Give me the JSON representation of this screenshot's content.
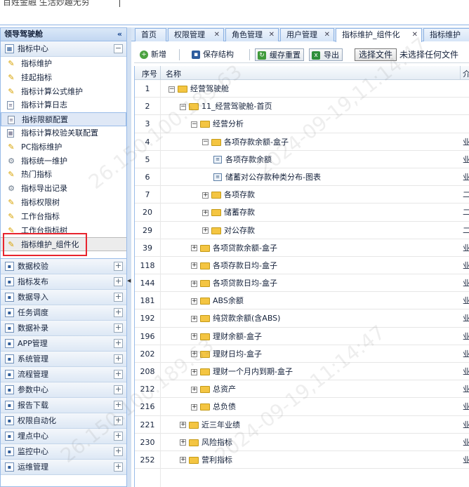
{
  "header": {
    "brand": "百姓金融 生活妙趣无穷"
  },
  "sidebar": {
    "title": "领导驾驶舱",
    "collapse_glyph": "«",
    "open_group": "指标中心",
    "items": [
      {
        "label": "指标维护",
        "icon": "pencil-icon"
      },
      {
        "label": "挂起指标",
        "icon": "pencil-icon"
      },
      {
        "label": "指标计算公式维护",
        "icon": "pencil-icon"
      },
      {
        "label": "指标计算日志",
        "icon": "document-icon"
      },
      {
        "label": "指标限额配置",
        "icon": "document-icon"
      },
      {
        "label": "指标计算校验关联配置",
        "icon": "table-icon"
      },
      {
        "label": "PC指标维护",
        "icon": "pencil-icon"
      },
      {
        "label": "指标统一维护",
        "icon": "gear-icon"
      },
      {
        "label": "热门指标",
        "icon": "pencil-icon"
      },
      {
        "label": "指标导出记录",
        "icon": "gear-icon"
      },
      {
        "label": "指标权限树",
        "icon": "pencil-icon"
      },
      {
        "label": "工作台指标",
        "icon": "pencil-icon"
      },
      {
        "label": "工作台指标树",
        "icon": "pencil-icon"
      },
      {
        "label": "指标维护_组件化",
        "icon": "pencil-icon"
      }
    ],
    "groups": [
      "数据校验",
      "指标发布",
      "数据导入",
      "任务调度",
      "数据补录",
      "APP管理",
      "系统管理",
      "流程管理",
      "参数中心",
      "报告下载",
      "权限自动化",
      "埋点中心",
      "监控中心",
      "运维管理"
    ]
  },
  "tabs": [
    "首页",
    "权限管理",
    "角色管理",
    "用户管理",
    "指标维护_组件化",
    "指标维护"
  ],
  "toolbar": {
    "add": "新增",
    "save_structure": "保存结构",
    "cache_reset": "缓存重置",
    "export": "导出",
    "choose_file": "选择文件",
    "no_file": "未选择任何文件"
  },
  "grid": {
    "headers": {
      "num": "序号",
      "name": "名称",
      "extra": "介"
    },
    "rows": [
      {
        "num": "1",
        "name": "经营驾驶舱",
        "level": 0,
        "type": "folder",
        "toggle": "−",
        "extra": ""
      },
      {
        "num": "2",
        "name": "11_经营驾驶舱-首页",
        "level": 1,
        "type": "folder",
        "toggle": "−",
        "extra": ""
      },
      {
        "num": "3",
        "name": "经营分析",
        "level": 2,
        "type": "folder",
        "toggle": "−",
        "extra": ""
      },
      {
        "num": "4",
        "name": "各项存款余额-盒子",
        "level": 3,
        "type": "folder",
        "toggle": "−",
        "extra": "业"
      },
      {
        "num": "5",
        "name": "各项存款余额",
        "level": 4,
        "type": "leaf",
        "toggle": "",
        "extra": "业"
      },
      {
        "num": "6",
        "name": "储蓄对公存款种类分布-图表",
        "level": 4,
        "type": "leaf",
        "toggle": "",
        "extra": "业"
      },
      {
        "num": "7",
        "name": "各项存款",
        "level": 3,
        "type": "folder",
        "toggle": "+",
        "extra": "二"
      },
      {
        "num": "20",
        "name": "储蓄存款",
        "level": 3,
        "type": "folder",
        "toggle": "+",
        "extra": "二"
      },
      {
        "num": "29",
        "name": "对公存款",
        "level": 3,
        "type": "folder",
        "toggle": "+",
        "extra": "二"
      },
      {
        "num": "39",
        "name": "各项贷款余额-盒子",
        "level": 2,
        "type": "folder",
        "toggle": "+",
        "extra": "业"
      },
      {
        "num": "118",
        "name": "各项存款日均-盒子",
        "level": 2,
        "type": "folder",
        "toggle": "+",
        "extra": "业"
      },
      {
        "num": "144",
        "name": "各项贷款日均-盒子",
        "level": 2,
        "type": "folder",
        "toggle": "+",
        "extra": "业"
      },
      {
        "num": "181",
        "name": "ABS余额",
        "level": 2,
        "type": "folder",
        "toggle": "+",
        "extra": "业"
      },
      {
        "num": "192",
        "name": "纯贷款余额(含ABS)",
        "level": 2,
        "type": "folder",
        "toggle": "+",
        "extra": "业"
      },
      {
        "num": "196",
        "name": "理财余额-盒子",
        "level": 2,
        "type": "folder",
        "toggle": "+",
        "extra": "业"
      },
      {
        "num": "202",
        "name": "理财日均-盒子",
        "level": 2,
        "type": "folder",
        "toggle": "+",
        "extra": "业"
      },
      {
        "num": "208",
        "name": "理财一个月内到期-盒子",
        "level": 2,
        "type": "folder",
        "toggle": "+",
        "extra": "业"
      },
      {
        "num": "212",
        "name": "总资产",
        "level": 2,
        "type": "folder",
        "toggle": "+",
        "extra": "业"
      },
      {
        "num": "216",
        "name": "总负债",
        "level": 2,
        "type": "folder",
        "toggle": "+",
        "extra": "业"
      },
      {
        "num": "221",
        "name": "近三年业绩",
        "level": 1,
        "type": "folder",
        "toggle": "+",
        "extra": "业"
      },
      {
        "num": "230",
        "name": "风险指标",
        "level": 1,
        "type": "folder",
        "toggle": "+",
        "extra": "业"
      },
      {
        "num": "252",
        "name": "营利指标",
        "level": 1,
        "type": "folder",
        "toggle": "+",
        "extra": "业"
      }
    ]
  },
  "watermark": [
    "26.150.100.189.63",
    "2024-09-19,11:14:47"
  ],
  "colors": {
    "panel_border": "#99bbe8",
    "highlight_box": "#e8242e",
    "folder": "#f4c542"
  }
}
